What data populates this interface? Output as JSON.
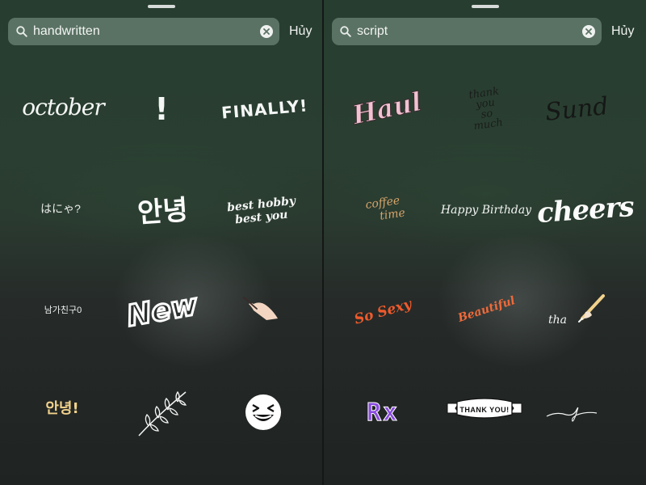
{
  "left_panel": {
    "search": {
      "query": "handwritten",
      "cancel_label": "Hủy"
    },
    "stickers": {
      "october": "october",
      "exclamation": "!",
      "finally": "FINALLY!",
      "hello_japanese": "はにゃ?",
      "annyeong_large": "안녕",
      "best_hobby_line1": "best hobby",
      "best_hobby_line2": "best you",
      "korean_small": "남가친구0",
      "new": "New",
      "annyeong_small": "안녕!"
    }
  },
  "right_panel": {
    "search": {
      "query": "script",
      "cancel_label": "Hủy"
    },
    "stickers": {
      "haul": "Haul",
      "thank_line1": "thank",
      "thank_line2": "you",
      "thank_line3": "so",
      "thank_line4": "much",
      "sund": "Sund",
      "coffee_line1": "coffee",
      "coffee_line2": "time",
      "happy_birthday": "Happy Birthday",
      "cheers": "cheers",
      "so_sexy": "So Sexy",
      "beautiful": "Beautiful",
      "tha": "tha",
      "rx": "Rx",
      "thank_you_banner": "THANK YOU!"
    }
  },
  "colors": {
    "search_bg": "#5a7263",
    "haul_pink": "#f2c2d2",
    "coffee_gold": "#d6a46a",
    "so_sexy_orange": "#ef5a2c",
    "beautiful_orange": "#ef6a3a",
    "rx_purple": "#8a4ae0",
    "star_gold": "#f2d28c"
  },
  "icons": {
    "search": "search-icon",
    "clear": "clear-icon",
    "hand_pen": "hand-pen-icon",
    "twig": "twig-icon",
    "laughing_emoji": "laughing-face-icon",
    "pencil_hand": "pencil-hand-icon",
    "squiggle": "squiggle-icon"
  }
}
